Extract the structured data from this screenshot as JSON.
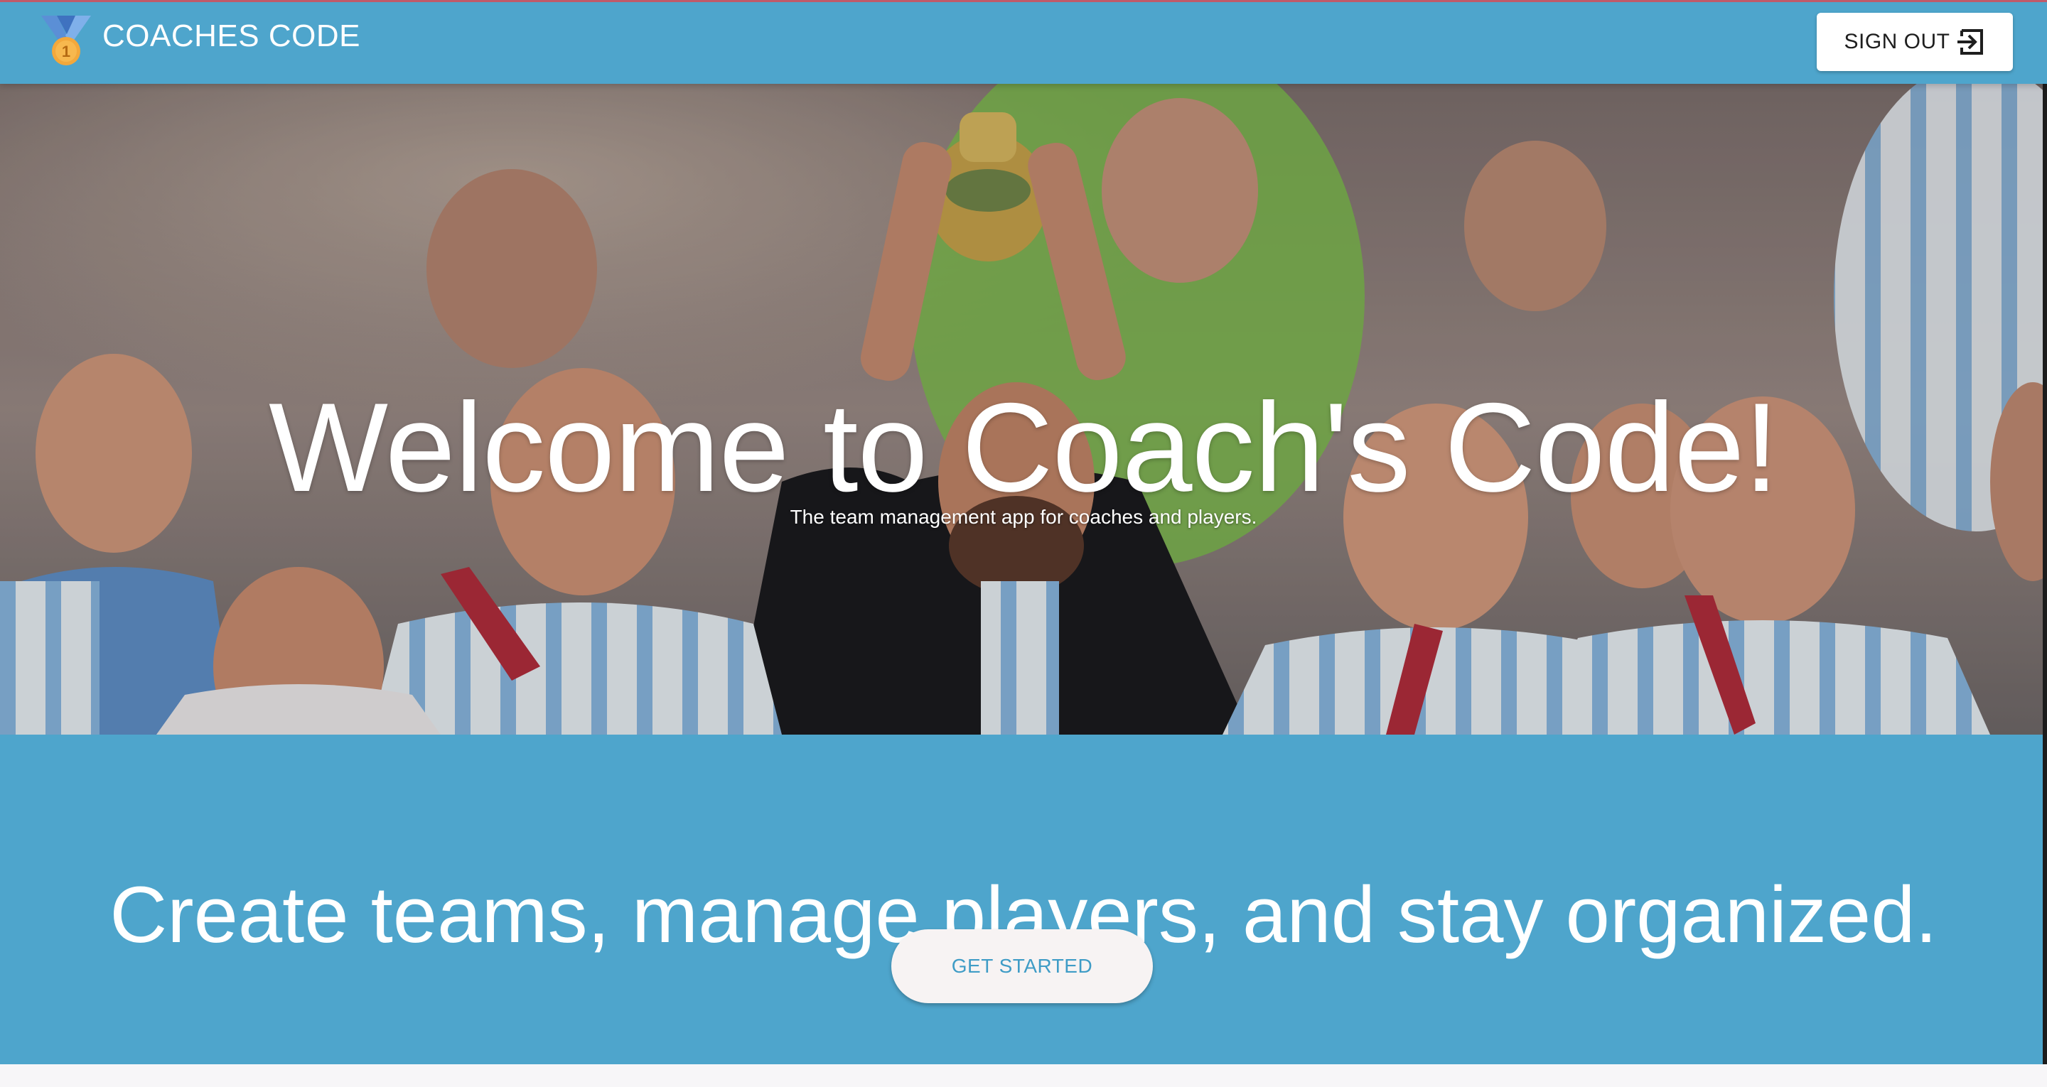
{
  "header": {
    "brand_name": "COACHES CODE",
    "logo_icon": "medal-icon",
    "signout_label": "SIGN OUT",
    "signout_icon": "exit-icon"
  },
  "hero": {
    "title": "Welcome to Coach's Code!",
    "subtitle": "The team management app for coaches and players."
  },
  "promo": {
    "heading": "Create teams, manage players, and stay organized.",
    "cta_label": "GET STARTED"
  },
  "colors": {
    "primary": "#4ea5cc",
    "cta_text": "#3f9cc6",
    "white": "#ffffff"
  }
}
